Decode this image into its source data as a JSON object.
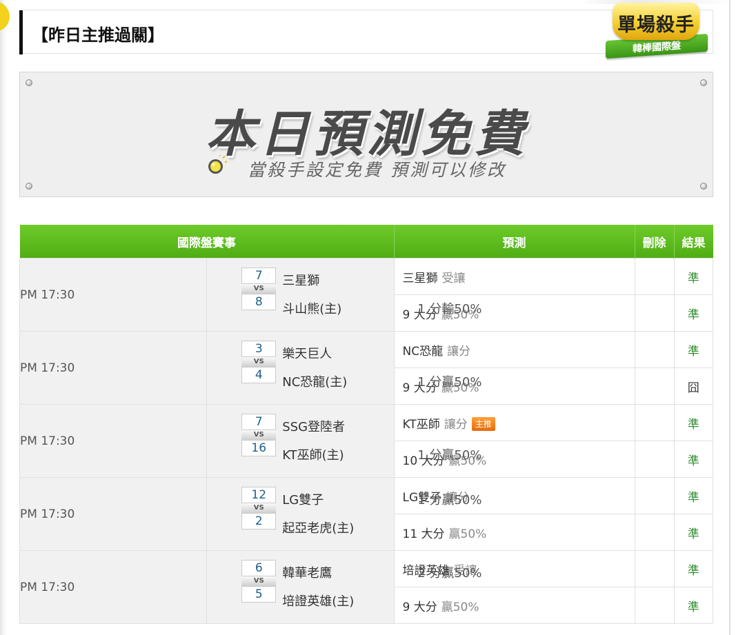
{
  "header": {
    "title": "【昨日主推過關】"
  },
  "badge": {
    "main": "單場殺手",
    "ribbon": "韓棒國際盤"
  },
  "banner": {
    "headline": "本日預測免費",
    "subtitle": "當殺手設定免費 預測可以修改"
  },
  "table": {
    "headers": {
      "match": "國際盤賽事",
      "prediction": "預測",
      "delete": "刪除",
      "result": "結果"
    },
    "rows": [
      {
        "time": "PM 17:30",
        "away": "三星獅",
        "away_score": "7",
        "home": "斗山熊(主)",
        "home_score": "8",
        "line": "1 分輸50%",
        "line_row": 2,
        "pred1_team": "三星獅",
        "pred1_type": "受讓",
        "pred1_tag": "",
        "result1": "準",
        "pred2_main": "9 大分",
        "pred2_odds": "贏50%",
        "result2": "準"
      },
      {
        "time": "PM 17:30",
        "away": "樂天巨人",
        "away_score": "3",
        "home": "NC恐龍(主)",
        "home_score": "4",
        "line": "1 分贏50%",
        "line_row": 2,
        "pred1_team": "NC恐龍",
        "pred1_type": "讓分",
        "pred1_tag": "",
        "result1": "準",
        "pred2_main": "9 大分",
        "pred2_odds": "贏50%",
        "result2": "囧"
      },
      {
        "time": "PM 17:30",
        "away": "SSG登陸者",
        "away_score": "7",
        "home": "KT巫師(主)",
        "home_score": "16",
        "line": "1 分贏50%",
        "line_row": 2,
        "pred1_team": "KT巫師",
        "pred1_type": "讓分",
        "pred1_tag": "主推",
        "result1": "準",
        "pred2_main": "10 大分",
        "pred2_odds": "贏50%",
        "result2": "準"
      },
      {
        "time": "PM 17:30",
        "away": "LG雙子",
        "away_score": "12",
        "home": "起亞老虎(主)",
        "home_score": "2",
        "line": "1 分贏50%",
        "line_row": 1,
        "pred1_team": "LG雙子",
        "pred1_type": "讓分",
        "pred1_tag": "",
        "result1": "準",
        "pred2_main": "11 大分",
        "pred2_odds": "贏50%",
        "result2": "準"
      },
      {
        "time": "PM 17:30",
        "away": "韓華老鷹",
        "away_score": "6",
        "home": "培證英雄(主)",
        "home_score": "5",
        "line": "2 分贏50%",
        "line_row": 1,
        "pred1_team": "培證英雄",
        "pred1_type": "受讓",
        "pred1_tag": "",
        "result1": "準",
        "pred2_main": "9 大分",
        "pred2_odds": "贏50%",
        "result2": "準"
      }
    ]
  }
}
